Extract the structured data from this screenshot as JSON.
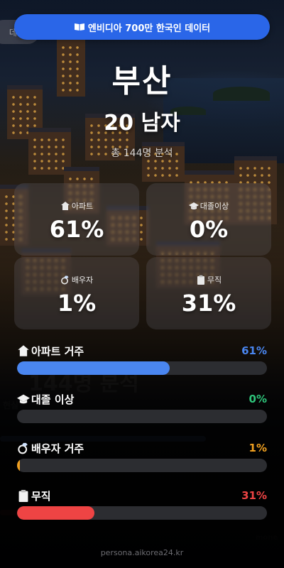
{
  "banner": {
    "text": "엔비디아 700만 한국인 데이터",
    "icon": "book-icon"
  },
  "back_chip": {
    "label": "데이터"
  },
  "profile": {
    "city": "부산",
    "demographic": "20 남자",
    "count_text": "총 144명 분석"
  },
  "cards": [
    {
      "icon": "house-icon",
      "label": "아파트",
      "value": "61%"
    },
    {
      "icon": "graduation-cap-icon",
      "label": "대졸이상",
      "value": "0%"
    },
    {
      "icon": "ring-icon",
      "label": "배우자",
      "value": "1%"
    },
    {
      "icon": "clipboard-icon",
      "label": "무직",
      "value": "31%"
    }
  ],
  "bars": [
    {
      "icon": "house-icon",
      "label": "아파트 거주",
      "value_text": "61%",
      "fraction": 0.61,
      "color": "#4a86f0"
    },
    {
      "icon": "graduation-cap-icon",
      "label": "대졸 이상",
      "value_text": "0%",
      "fraction": 0.0,
      "color": "#2ec47a"
    },
    {
      "icon": "ring-icon",
      "label": "배우자 거주",
      "value_text": "1%",
      "fraction": 0.01,
      "color": "#f0a020"
    },
    {
      "icon": "clipboard-icon",
      "label": "무직",
      "value_text": "31%",
      "fraction": 0.31,
      "color": "#ee4444"
    }
  ],
  "footer": {
    "text": "persona.aikorea24.kr"
  }
}
